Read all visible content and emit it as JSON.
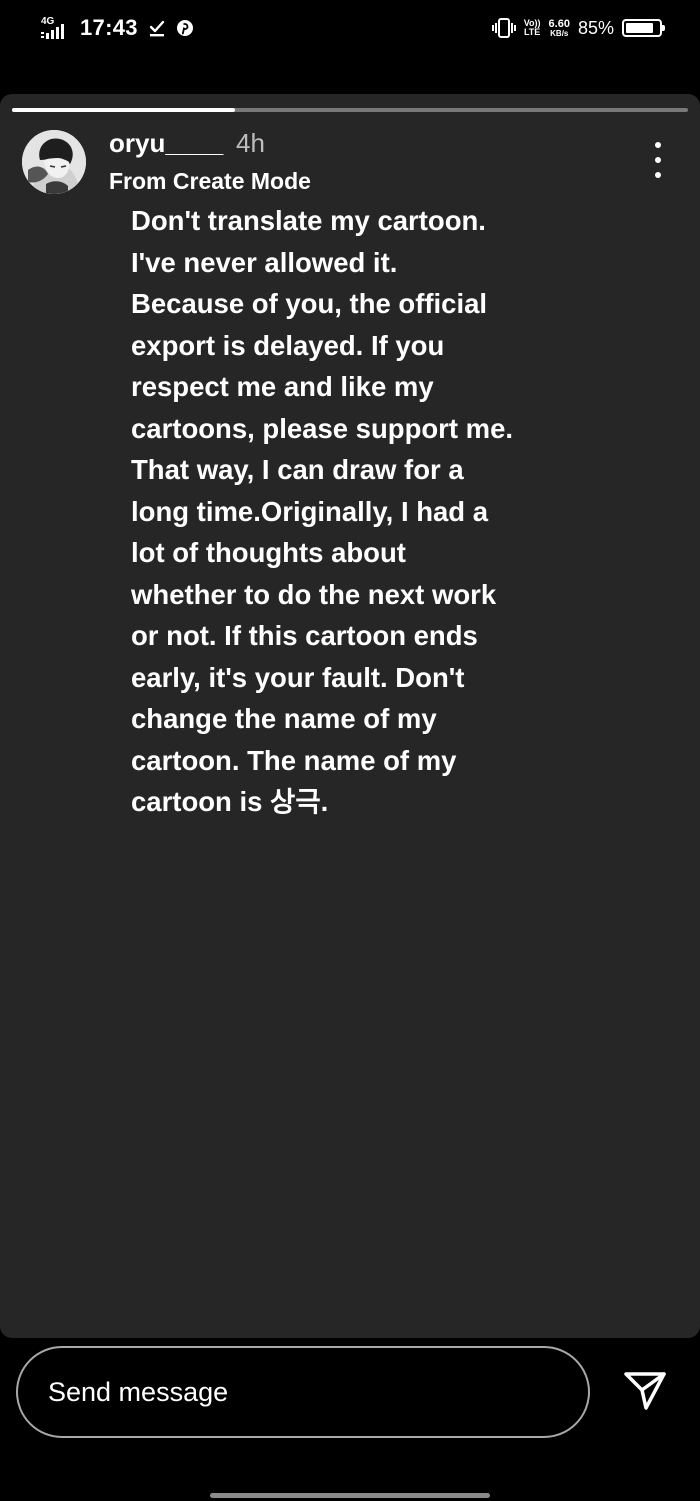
{
  "status_bar": {
    "network_gen": "4G",
    "time": "17:43",
    "lte_label_top": "Vo))",
    "lte_label_bottom": "LTE",
    "speed_value": "6.60",
    "speed_unit": "KB/s",
    "battery_percent_text": "85%",
    "battery_level": 0.85,
    "icons": [
      "signal-icon",
      "download-done-icon",
      "pinterest-icon",
      "vibrate-icon",
      "battery-icon"
    ]
  },
  "story": {
    "progress": 0.33,
    "username": "oryu____",
    "time_ago": "4h",
    "subtitle": "From Create Mode",
    "text": "Don't translate my cartoon.\nI've never allowed it.\nBecause of you, the official\nexport is delayed. If you\nrespect me and like my\ncartoons, please support me.\nThat way, I can draw for a\nlong time.Originally, I had a\nlot of thoughts about\nwhether to do the next work\nor not. If this cartoon ends\nearly, it's your fault. Don't\nchange the name of my\ncartoon. The name of my\ncartoon is 상극.",
    "background_color": "#262626"
  },
  "reply": {
    "placeholder": "Send message"
  }
}
